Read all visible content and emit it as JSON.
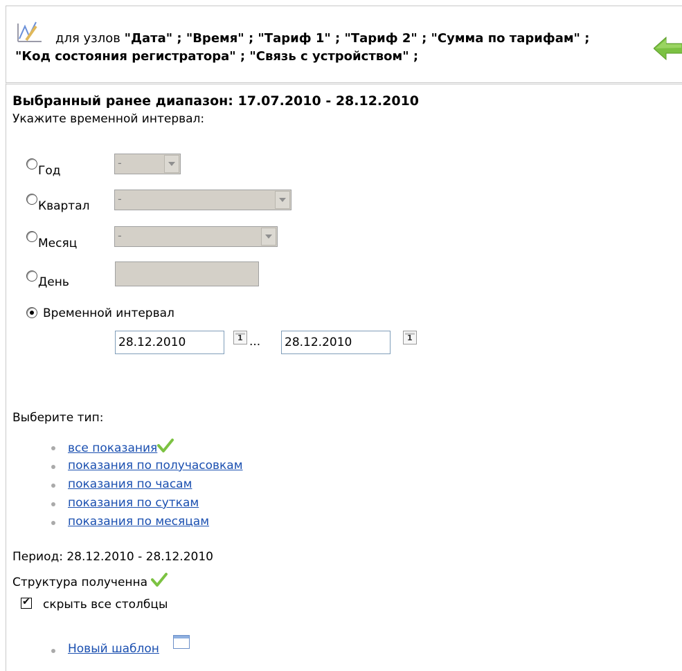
{
  "nodes_bar": {
    "prefix": "для узлов",
    "line1_nodes": "\"Дата\" ; \"Время\" ; \"Тариф 1\" ; \"Тариф 2\" ; \"Сумма по тарифам\" ;",
    "line2_nodes": "\"Код состояния регистратора\" ; \"Связь с устройством\" ;"
  },
  "range": {
    "heading": "Выбранный ранее диапазон: 17.07.2010 - 28.12.2010",
    "prompt": "Укажите временной интервал:"
  },
  "interval_options": {
    "year": {
      "label": "Год",
      "value": "-"
    },
    "quarter": {
      "label": "Квартал",
      "value": "-"
    },
    "month": {
      "label": "Месяц",
      "value": "-"
    },
    "day": {
      "label": "День"
    },
    "custom": {
      "label": "Временной интервал",
      "selected": true,
      "from": "28.12.2010",
      "to": "28.12.2010",
      "separator": "..."
    }
  },
  "calendar_icon_text": "1",
  "type_section": {
    "label": "Выберите тип:",
    "items": [
      {
        "label": "все показания",
        "selected": true
      },
      {
        "label": "показания по получасовкам"
      },
      {
        "label": "показания по часам"
      },
      {
        "label": "показания по суткам"
      },
      {
        "label": "показания по месяцам"
      }
    ]
  },
  "period_text": "Период: 28.12.2010 - 28.12.2010",
  "structure_text": "Структура полученна",
  "hide_columns": {
    "label": "скрыть все столбцы",
    "checked": true
  },
  "template_link": "Новый шаблон",
  "icons": [
    "chart-icon",
    "back-arrow-icon",
    "calendar-icon",
    "checkmark-icon",
    "window-icon"
  ],
  "colors": {
    "link": "#1a4fb0",
    "check_green": "#7cc242",
    "arrow_green": "#7bc142",
    "disabled_bg": "#d4d0c8"
  }
}
